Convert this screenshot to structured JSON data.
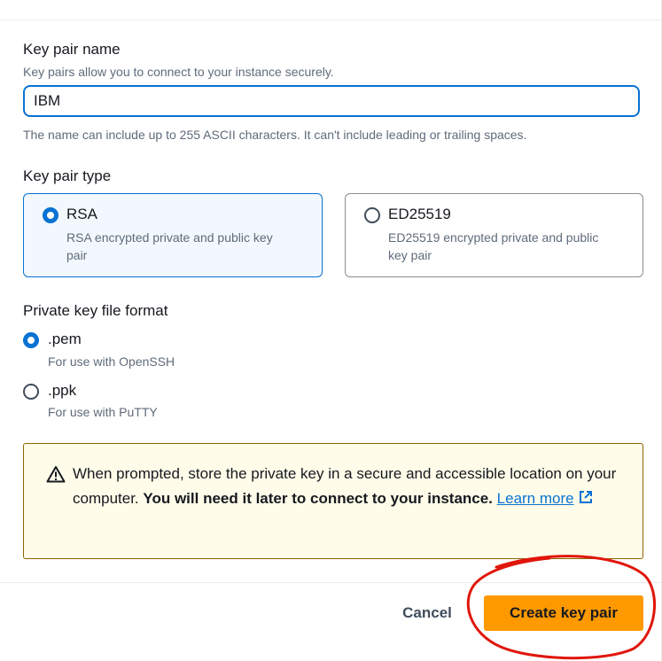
{
  "key_pair_name": {
    "label": "Key pair name",
    "description": "Key pairs allow you to connect to your instance securely.",
    "value": "IBM",
    "constraint": "The name can include up to 255 ASCII characters. It can't include leading or trailing spaces."
  },
  "key_pair_type": {
    "label": "Key pair type",
    "options": [
      {
        "label": "RSA",
        "description_line1": "RSA encrypted private and public key",
        "description_line2": "pair",
        "selected": true
      },
      {
        "label": "ED25519",
        "description_line1": "ED25519 encrypted private and public",
        "description_line2": "key pair",
        "selected": false
      }
    ]
  },
  "private_key_format": {
    "label": "Private key file format",
    "options": [
      {
        "label": ".pem",
        "description": "For use with OpenSSH",
        "selected": true
      },
      {
        "label": ".ppk",
        "description": "For use with PuTTY",
        "selected": false
      }
    ]
  },
  "alert": {
    "type": "warning",
    "text_plain": "When prompted, store the private key in a secure and accessible location on your computer.",
    "text_bold": "You will need it later to connect to your instance.",
    "link_label": "Learn more"
  },
  "footer": {
    "cancel_label": "Cancel",
    "create_label": "Create key pair"
  },
  "colors": {
    "accent": "#0972d3",
    "primary_button": "#ff9900",
    "warning_border": "#8d6605",
    "warning_background": "#fffce9",
    "annotation": "#e0160b"
  }
}
